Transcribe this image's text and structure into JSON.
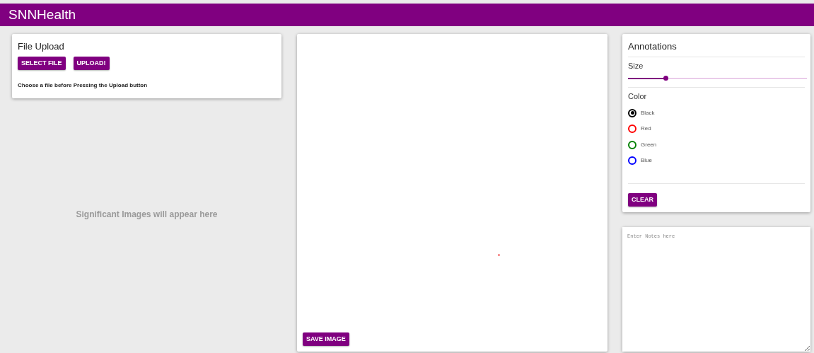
{
  "header": {
    "title": "SNNHealth"
  },
  "upload": {
    "title": "File Upload",
    "buttons": [
      "SELECT FILE",
      "UPLOAD!"
    ],
    "hint": "Choose a file before Pressing the Upload button"
  },
  "images_placeholder": "Significant Images will appear here",
  "canvas": {
    "button": "SAVE IMAGE"
  },
  "annotations": {
    "title": "Annotations",
    "size_label": "Size",
    "size": {
      "level": 0.21
    },
    "color_label": "Color",
    "colors": [
      {
        "label": "Black",
        "color": "#000000",
        "selected": true
      },
      {
        "label": "Red",
        "color": "#ff0000",
        "selected": false
      },
      {
        "label": "Green",
        "color": "#008000",
        "selected": false
      },
      {
        "label": "Blue",
        "color": "#0000ff",
        "selected": false
      }
    ],
    "button": "CLEAR"
  },
  "notes": {
    "placeholder": "Enter Notes here"
  }
}
